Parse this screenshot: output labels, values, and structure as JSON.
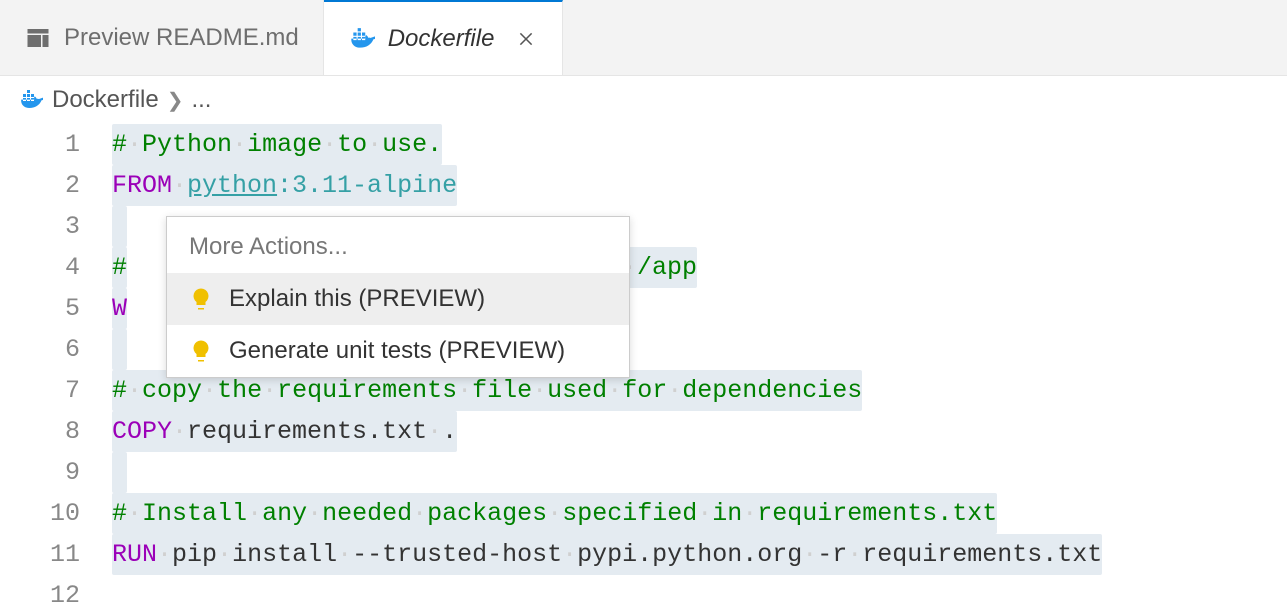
{
  "tabs": {
    "inactive": {
      "label": "Preview README.md"
    },
    "active": {
      "label": "Dockerfile"
    }
  },
  "breadcrumb": {
    "file": "Dockerfile",
    "segment": "..."
  },
  "lines": [
    "1",
    "2",
    "3",
    "4",
    "5",
    "6",
    "7",
    "8",
    "9",
    "10",
    "11",
    "12"
  ],
  "code": {
    "l1_comment": "# Python image to use.",
    "l2_keyword": "FROM",
    "l2_image": "python",
    "l2_tag": ":3.11-alpine",
    "l4_prefix": "#",
    "l4_suffix": "o /app",
    "l5_prefix": "W",
    "l7_comment": "# copy the requirements file used for dependencies",
    "l8_keyword": "COPY",
    "l8_args": "requirements.txt .",
    "l10_comment": "# Install any needed packages specified in requirements.txt",
    "l11_keyword": "RUN",
    "l11_args": "pip install --trusted-host pypi.python.org -r requirements.txt"
  },
  "menu": {
    "title": "More Actions...",
    "item1": "Explain this (PREVIEW)",
    "item2": "Generate unit tests (PREVIEW)"
  }
}
